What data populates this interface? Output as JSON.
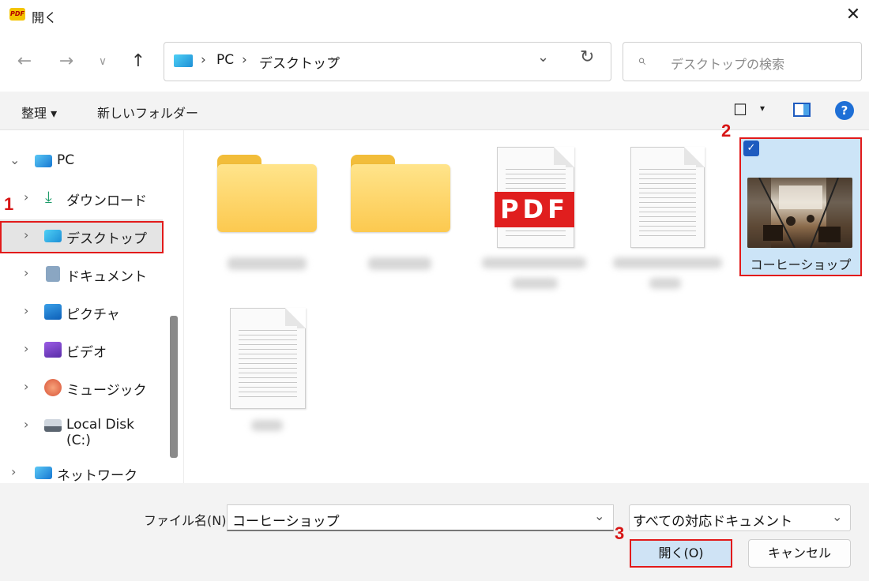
{
  "window": {
    "title": "開く",
    "app_icon_text": "PDF",
    "close_icon": "close-icon"
  },
  "nav": {
    "back_icon": "←",
    "forward_icon": "→",
    "recent_icon": "∨",
    "up_icon": "↑"
  },
  "address": {
    "crumbs": [
      "PC",
      "デスクトップ"
    ],
    "separator": "›"
  },
  "search": {
    "placeholder": "デスクトップの検索"
  },
  "toolbar": {
    "organize": "整理 ▾",
    "new_folder": "新しいフォルダー",
    "view_icon": "☐",
    "view_drop": "▾",
    "help": "?"
  },
  "sidebar": {
    "items": [
      {
        "label": "PC",
        "icon": "pc-icon"
      },
      {
        "label": "ダウンロード",
        "icon": "download-icon"
      },
      {
        "label": "デスクトップ",
        "icon": "desktop-icon",
        "selected": true
      },
      {
        "label": "ドキュメント",
        "icon": "document-icon"
      },
      {
        "label": "ピクチャ",
        "icon": "picture-icon"
      },
      {
        "label": "ビデオ",
        "icon": "video-icon"
      },
      {
        "label": "ミュージック",
        "icon": "music-icon"
      },
      {
        "label": "Local Disk (C:)",
        "icon": "disk-icon"
      },
      {
        "label": "ネットワーク",
        "icon": "network-icon"
      }
    ]
  },
  "files": {
    "pdf_badge": "PDF",
    "selected_file": {
      "name": "コーヒーショップ",
      "checked": true
    }
  },
  "footer": {
    "filename_label": "ファイル名(N):",
    "filename_value": "コーヒーショップ",
    "filetype_value": "すべての対応ドキュメント",
    "open_button": "開く(O)",
    "cancel_button": "キャンセル"
  },
  "annotations": {
    "marker_1": "1",
    "marker_2": "2",
    "marker_3": "3"
  },
  "colors": {
    "highlight_red": "#e21a1a",
    "selection_blue": "#cce4f7",
    "check_blue": "#1e5bbf"
  }
}
